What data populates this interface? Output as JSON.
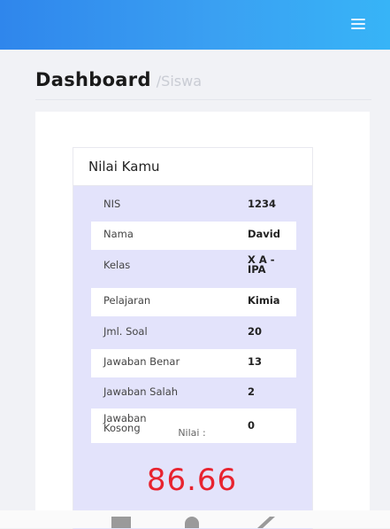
{
  "header": {
    "title": "Dashboard",
    "subtitle": "/Siswa",
    "menu_icon": "hamburger-menu-icon"
  },
  "card": {
    "title": "Nilai Kamu",
    "rows": [
      {
        "label": "NIS",
        "value": "1234"
      },
      {
        "label": "Nama",
        "value": "David"
      },
      {
        "label": "Kelas",
        "value": "X A - IPA"
      },
      {
        "label": "Pelajaran",
        "value": "Kimia"
      },
      {
        "label": "Jml. Soal",
        "value": "20"
      },
      {
        "label": "Jawaban Benar",
        "value": "13"
      },
      {
        "label": "Jawaban Salah",
        "value": "2"
      },
      {
        "label": "Jawaban Kosong",
        "value": "0"
      }
    ],
    "score_label": "Nilai :",
    "score_value": "86.66"
  },
  "colors": {
    "topbar_start": "#2f86ec",
    "topbar_end": "#37b4f7",
    "score": "#e8232f",
    "card_body": "#e3e3fb"
  }
}
